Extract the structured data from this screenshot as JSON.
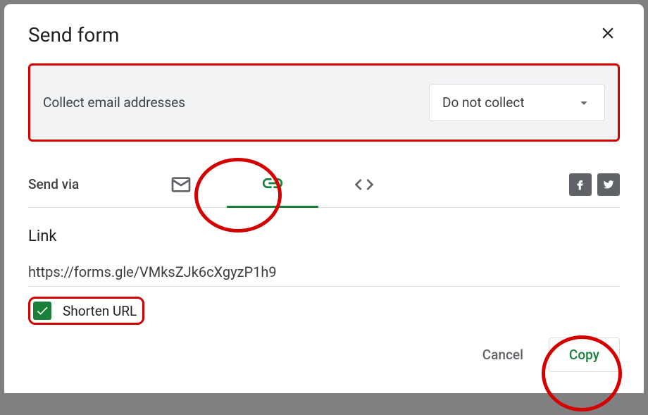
{
  "dialog": {
    "title": "Send form",
    "collect_label": "Collect email addresses",
    "collect_value": "Do not collect",
    "send_via_label": "Send via",
    "tabs": {
      "email": "email-icon",
      "link": "link-icon",
      "embed": "embed-icon"
    },
    "link_section": {
      "heading": "Link",
      "url": "https://forms.gle/VMksZJk6cXgyzP1h9",
      "shorten_label": "Shorten URL",
      "shorten_checked": true
    },
    "actions": {
      "cancel": "Cancel",
      "copy": "Copy"
    }
  }
}
